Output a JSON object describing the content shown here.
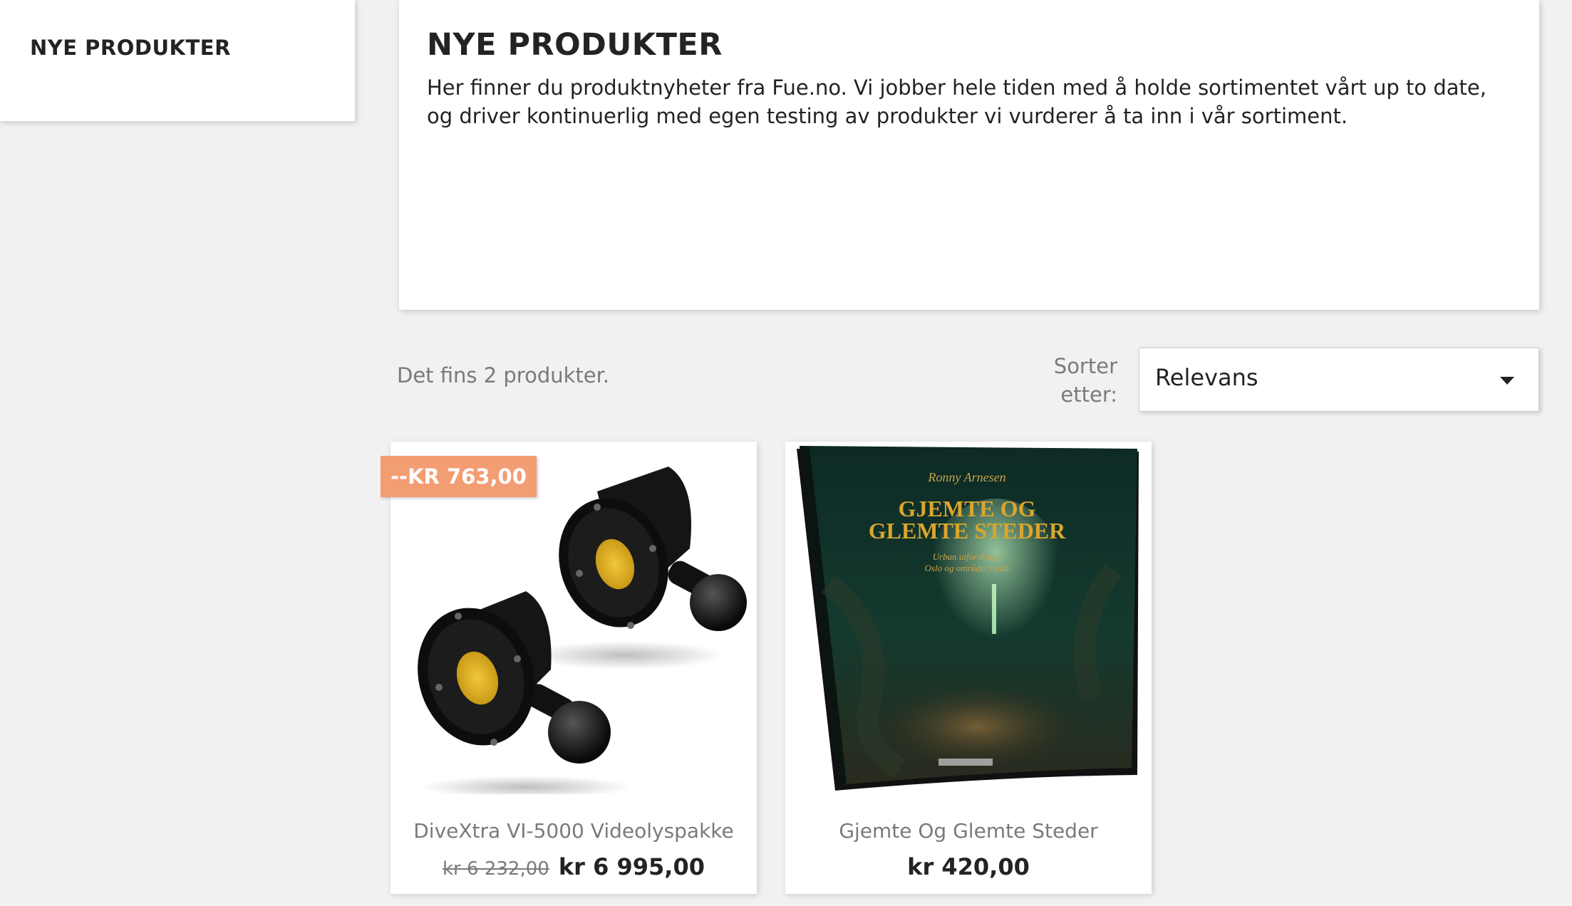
{
  "sidebar": {
    "title": "NYE PRODUKTER"
  },
  "category": {
    "title": "NYE PRODUKTER",
    "description": "Her finner du produktnyheter fra Fue.no. Vi jobber hele tiden med å holde sortimentet vårt up to date, og driver kontinuerlig med egen testing av produkter vi vurderer å ta inn i vår sortiment."
  },
  "toolbar": {
    "product_count": "Det fins 2 produkter.",
    "sort_label": "Sorter etter:",
    "sort_value": "Relevans"
  },
  "products": [
    {
      "name": "DiveXtra VI-5000 Videolyspakke",
      "discount_badge": "--KR 763,00",
      "regular_price": "kr 6 232,00",
      "price": "kr 6 995,00",
      "image_icon": "video-light-pair-image"
    },
    {
      "name": "Gjemte Og Glemte Steder",
      "price": "kr 420,00",
      "image_icon": "book-cover-image",
      "cover": {
        "author": "Ronny Arnesen",
        "title_line_1": "GJEMTE OG",
        "title_line_2": "GLEMTE STEDER",
        "subtitle_line_1": "Urban utforsking i",
        "subtitle_line_2": "Oslo og området rundt"
      }
    }
  ],
  "colors": {
    "background": "#f1f1f1",
    "card": "#ffffff",
    "discount_badge": "#f39d72",
    "text_primary": "#232323",
    "text_muted": "#7a7a7a"
  }
}
